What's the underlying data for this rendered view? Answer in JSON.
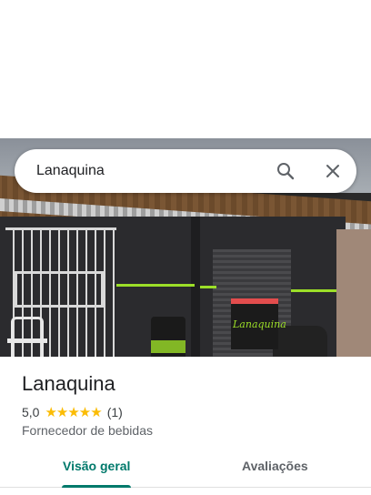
{
  "search": {
    "value": "Lanaquina",
    "icon_search": "search-icon",
    "icon_close": "close-icon"
  },
  "photo": {
    "sign_text": "Lanaquina"
  },
  "place": {
    "name": "Lanaquina",
    "rating": "5,0",
    "stars": "★★★★★",
    "review_count": "(1)",
    "category": "Fornecedor de bebidas"
  },
  "tabs": {
    "items": [
      {
        "label": "Visão geral",
        "active": true
      },
      {
        "label": "Avaliações",
        "active": false
      }
    ]
  },
  "colors": {
    "accent": "#00796b",
    "star": "#fbbc04"
  }
}
